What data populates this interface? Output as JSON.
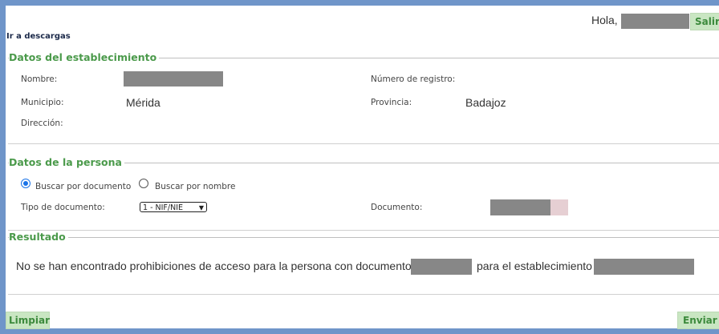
{
  "header": {
    "greeting": "Hola,",
    "logout_label": "Salir",
    "downloads_link": "Ir a descargas"
  },
  "establishment": {
    "title": "Datos del establecimiento",
    "name_label": "Nombre:",
    "name_value": "",
    "registry_label": "Número de registro:",
    "registry_value": "",
    "municipality_label": "Municipio:",
    "municipality_value": "Mérida",
    "province_label": "Provincia:",
    "province_value": "Badajoz",
    "address_label": "Dirección:",
    "address_value": ""
  },
  "person": {
    "title": "Datos de la persona",
    "search_by_document": "Buscar por documento",
    "search_by_name": "Buscar por nombre",
    "search_mode_selected": "document",
    "doc_type_label": "Tipo de documento:",
    "doc_type_value": "1 - NIF/NIE",
    "document_label": "Documento:",
    "document_value": ""
  },
  "result": {
    "title": "Resultado",
    "message_part1": "No se han encontrado prohibiciones de acceso para la persona con documento",
    "message_part2": "para el establecimiento"
  },
  "footer": {
    "clear_label": "Limpiar",
    "send_label": "Enviar"
  },
  "colors": {
    "frame": "#6f95c9",
    "section_title": "#4b9a4b",
    "button_bg": "#c9e6c2",
    "redaction": "#878787"
  }
}
